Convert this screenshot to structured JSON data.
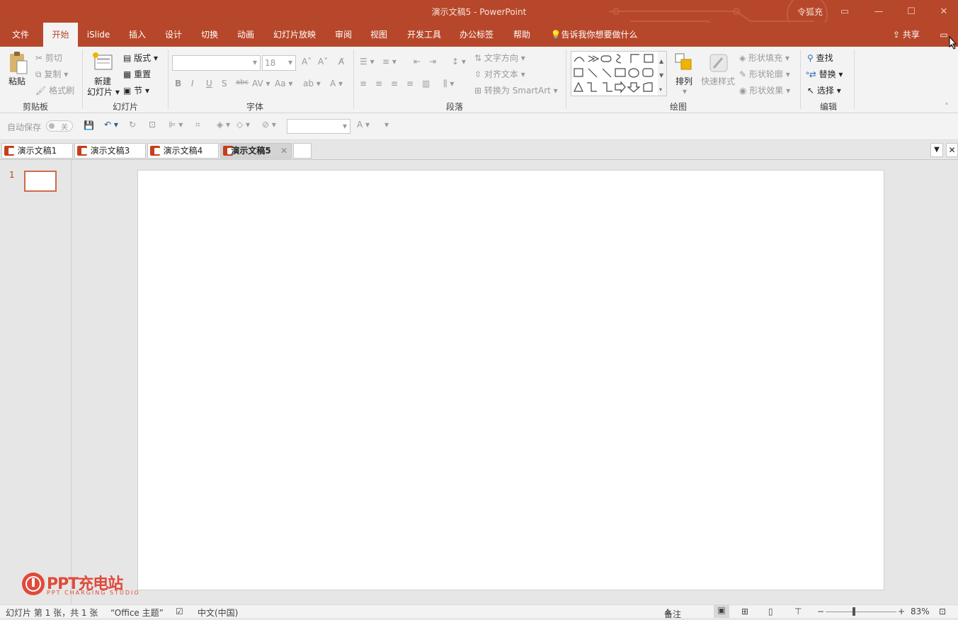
{
  "window": {
    "title": "演示文稿5  -  PowerPoint",
    "user": "令狐充"
  },
  "menu": {
    "tabs": [
      "文件",
      "开始",
      "iSlide",
      "插入",
      "设计",
      "切换",
      "动画",
      "幻灯片放映",
      "审阅",
      "视图",
      "开发工具",
      "办公标签",
      "帮助"
    ],
    "active_tab": "开始",
    "tell_me": "告诉我你想要做什么",
    "share": "共享"
  },
  "ribbon": {
    "clipboard": {
      "label": "剪贴板",
      "paste": "粘贴",
      "cut": "剪切",
      "copy": "复制",
      "format_painter": "格式刷"
    },
    "slides": {
      "label": "幻灯片",
      "new_slide_line1": "新建",
      "new_slide_line2": "幻灯片",
      "layout": "版式",
      "reset": "重置",
      "section": "节"
    },
    "font": {
      "label": "字体",
      "font_name": "",
      "font_size": "18"
    },
    "paragraph": {
      "label": "段落",
      "text_direction": "文字方向",
      "align_text": "对齐文本",
      "convert_smartart": "转换为 SmartArt"
    },
    "drawing": {
      "label": "绘图",
      "arrange": "排列",
      "quick_styles": "快速样式",
      "shape_fill": "形状填充",
      "shape_outline": "形状轮廓",
      "shape_effects": "形状效果"
    },
    "editing": {
      "label": "编辑",
      "find": "查找",
      "replace": "替换",
      "select": "选择"
    }
  },
  "qat": {
    "autosave_label": "自动保存",
    "autosave_state": "关"
  },
  "doc_tabs": [
    "演示文稿1",
    "演示文稿3",
    "演示文稿4",
    "演示文稿5"
  ],
  "active_doc_tab": "演示文稿5",
  "thumbnails": {
    "slide_number": "1"
  },
  "watermark": {
    "brand": "PPT充电站",
    "sub": "PPT CHARGING STUDIO"
  },
  "status": {
    "slide_info": "幻灯片 第 1 张，共 1 张",
    "theme": "“Office 主题”",
    "language": "中文(中国)",
    "notes": "备注",
    "zoom": "83%"
  },
  "colors": {
    "accent": "#b7472a",
    "ribbon_bg": "#f3f3f3",
    "app_bg": "#e6e6e6"
  }
}
